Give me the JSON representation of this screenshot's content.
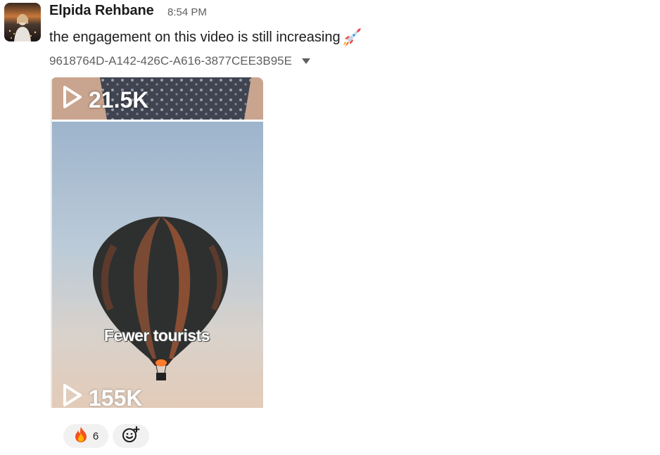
{
  "message": {
    "sender": "Elpida Rehbane",
    "time": "8:54 PM",
    "text": "the engagement on this video is still increasing",
    "emoji_icon": "rocket-icon"
  },
  "attachment": {
    "name": "9618764D-A142-426C-A616-3877CEE3B95E",
    "top_views": "21.5K",
    "caption": "Fewer tourists",
    "bottom_views": "155K"
  },
  "reactions": [
    {
      "icon": "fire-emoji-icon",
      "count": "6"
    }
  ],
  "add_reaction_icon": "add-reaction-icon"
}
